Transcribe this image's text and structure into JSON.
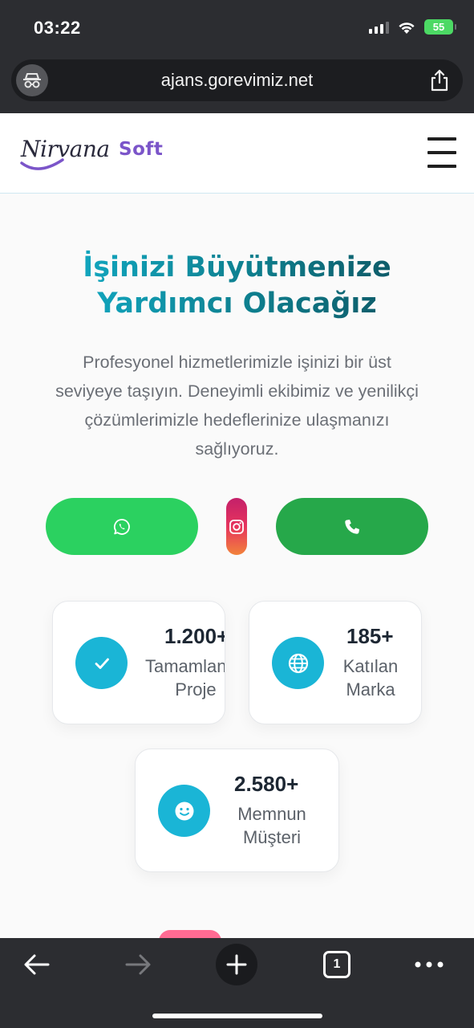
{
  "status_bar": {
    "time": "03:22",
    "battery": "55"
  },
  "browser": {
    "url": "ajans.gorevimiz.net",
    "tab_count": "1"
  },
  "header": {
    "logo_text_1": "Nirvana",
    "logo_text_2": "Soft"
  },
  "hero": {
    "title_line_1": "İşinizi Büyütmenize",
    "title_line_2": "Yardımcı Olacağız",
    "description": "Profesyonel hizmetlerimizle işinizi bir üst seviyeye taşıyın. Deneyimli ekibimiz ve yenilikçi çözümlerimizle hedeflerinize ulaşmanızı sağlıyoruz."
  },
  "cta": {
    "whatsapp_icon": "whatsapp-icon",
    "instagram_icon": "instagram-icon",
    "phone_icon": "phone-icon"
  },
  "stats": [
    {
      "value": "1.200+",
      "label_1": "Tamamlanan",
      "label_2": "Proje",
      "icon": "check-icon"
    },
    {
      "value": "185+",
      "label_1": "Katılan",
      "label_2": "Marka",
      "icon": "globe-icon"
    },
    {
      "value": "2.580+",
      "label_1": "Memnun",
      "label_2": "Müşteri",
      "icon": "smile-icon"
    }
  ],
  "colors": {
    "accent": "#1ab5d6",
    "whatsapp": "#2bd160",
    "phone": "#26a84a",
    "brand_purple": "#7b55c9",
    "chrome": "#2c2d31"
  }
}
